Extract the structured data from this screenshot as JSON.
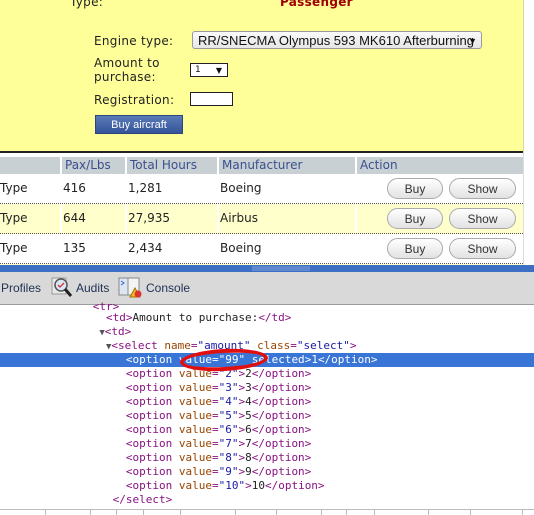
{
  "form": {
    "type_label": "Type:",
    "type_value": "Passenger",
    "engine_label": "Engine type:",
    "engine_value": "RR/SNECMA Olympus 593 MK610 Afterburning",
    "amount_label": "Amount to purchase:",
    "amount_value": "1",
    "registration_label": "Registration:",
    "registration_value": "",
    "buy_aircraft_label": "Buy aircraft"
  },
  "table": {
    "headers": [
      "",
      "Pax/Lbs",
      "Total Hours",
      "Manufacturer",
      "Action"
    ],
    "rows": [
      {
        "type": "Type",
        "pax": "416",
        "hours": "1,281",
        "manufacturer": "Boeing",
        "buy": "Buy",
        "show": "Show"
      },
      {
        "type": "Type",
        "pax": "644",
        "hours": "27,935",
        "manufacturer": "Airbus",
        "buy": "Buy",
        "show": "Show"
      },
      {
        "type": "Type",
        "pax": "135",
        "hours": "2,434",
        "manufacturer": "Boeing",
        "buy": "Buy",
        "show": "Show"
      }
    ]
  },
  "devtools": {
    "tabs": [
      {
        "label": "Profiles",
        "icon": "profiles-icon"
      },
      {
        "label": "Audits",
        "icon": "magnifier-icon"
      },
      {
        "label": "Console",
        "icon": "console-warning-icon"
      }
    ],
    "code": {
      "td_amount": "Amount to purchase:",
      "select_name": "amount",
      "select_class": "select",
      "selected_option": {
        "value": "99",
        "text": "1"
      },
      "options": [
        {
          "value": "2",
          "text": "2"
        },
        {
          "value": "3",
          "text": "3"
        },
        {
          "value": "4",
          "text": "4"
        },
        {
          "value": "5",
          "text": "5"
        },
        {
          "value": "6",
          "text": "6"
        },
        {
          "value": "7",
          "text": "7"
        },
        {
          "value": "8",
          "text": "8"
        },
        {
          "value": "9",
          "text": "9"
        },
        {
          "value": "10",
          "text": "10"
        }
      ]
    },
    "annotation_color": "#e01010",
    "selection_color": "#3875d7"
  }
}
